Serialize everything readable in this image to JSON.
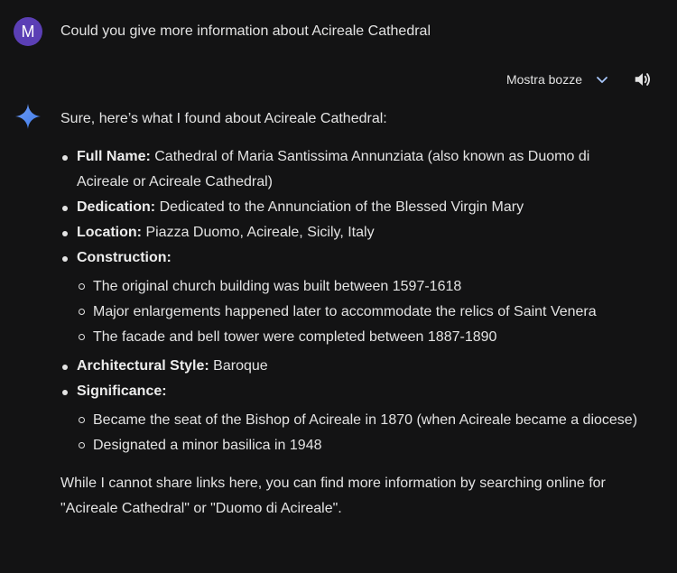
{
  "user": {
    "avatar_letter": "M",
    "message": "Could you give more information about Acireale Cathedral"
  },
  "toolbar": {
    "drafts_label": "Mostra bozze",
    "chevron_icon": "chevron-down-icon",
    "speaker_icon": "speaker-icon"
  },
  "response": {
    "intro": "Sure, here’s what I found about Acireale Cathedral:",
    "items": [
      {
        "label": "Full Name:",
        "text": " Cathedral of Maria Santissima Annunziata (also known as Duomo di Acireale or Acireale Cathedral)"
      },
      {
        "label": "Dedication:",
        "text": " Dedicated to the Annunciation of the Blessed Virgin Mary"
      },
      {
        "label": "Location:",
        "text": " Piazza Duomo, Acireale, Sicily, Italy"
      },
      {
        "label": "Construction:",
        "text": "",
        "sub": [
          "The original church building was built between 1597-1618",
          "Major enlargements happened later to accommodate the relics of Saint Venera",
          "The facade and bell tower were completed between 1887-1890"
        ]
      },
      {
        "label": "Architectural Style:",
        "text": " Baroque"
      },
      {
        "label": "Significance:",
        "text": "",
        "sub": [
          "Became the seat of the Bishop of Acireale in 1870 (when Acireale became a diocese)",
          "Designated a minor basilica in 1948"
        ]
      }
    ],
    "closing": "While I cannot share links here, you can find more information by searching online for \"Acireale Cathedral\" or \"Duomo di Acireale\"."
  },
  "colors": {
    "background": "#131314",
    "text": "#e3e3e3",
    "avatar": "#5b3fb5",
    "sparkle_blue": "#4f8ef7"
  }
}
